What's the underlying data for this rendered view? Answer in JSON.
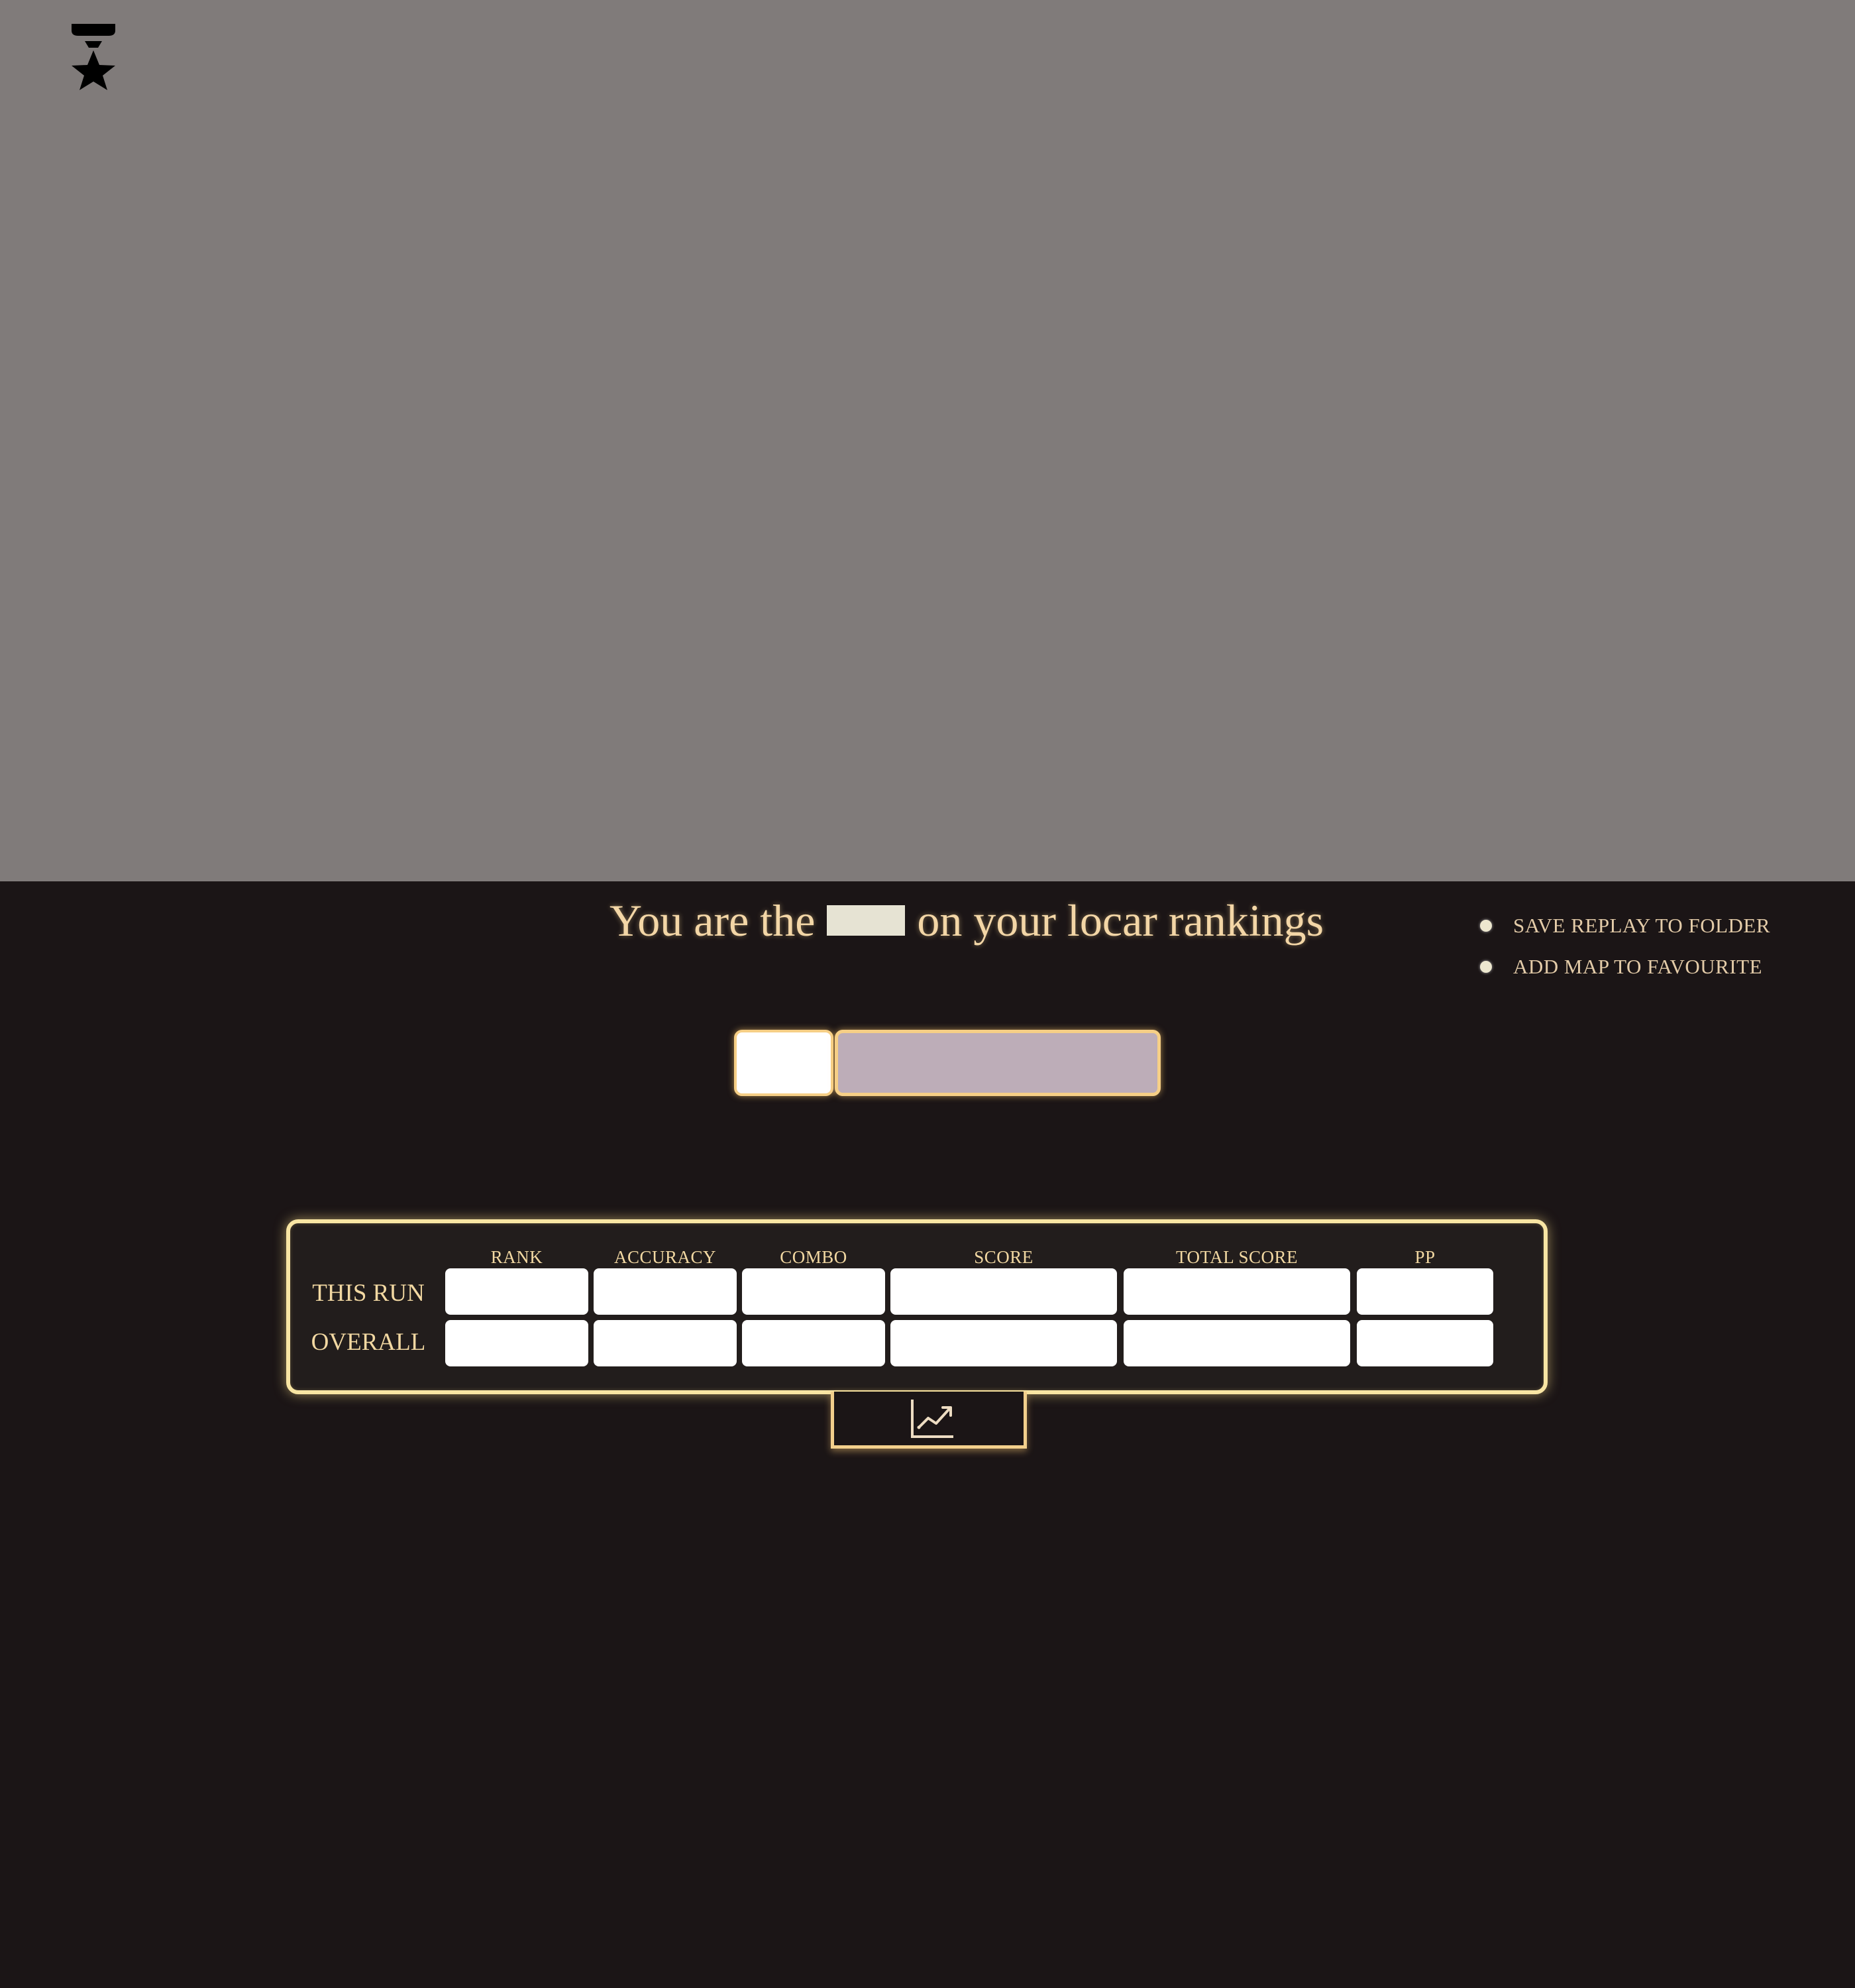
{
  "header": {
    "headline_before": "You are the",
    "headline_after": "on your locar rankings"
  },
  "options": [
    {
      "label": "SAVE REPLAY TO FOLDER"
    },
    {
      "label": "ADD MAP TO FAVOURITE"
    }
  ],
  "stats": {
    "columns": [
      "RANK",
      "ACCURACY",
      "COMBO",
      "SCORE",
      "TOTAL SCORE",
      "PP"
    ],
    "rows": [
      {
        "label": "THIS RUN",
        "values": [
          "",
          "",
          "",
          "",
          "",
          ""
        ]
      },
      {
        "label": "OVERALL",
        "values": [
          "",
          "",
          "",
          "",
          "",
          ""
        ]
      }
    ]
  },
  "icons": {
    "top_left": "medal-star-icon",
    "graph": "line-chart-icon"
  },
  "colors": {
    "top_background": "#807b7a",
    "bottom_background": "#1b1516",
    "accent_gold": "#f8e5a3",
    "text_gold": "#f3d6a6",
    "selector_fill": "#bdadb8"
  }
}
